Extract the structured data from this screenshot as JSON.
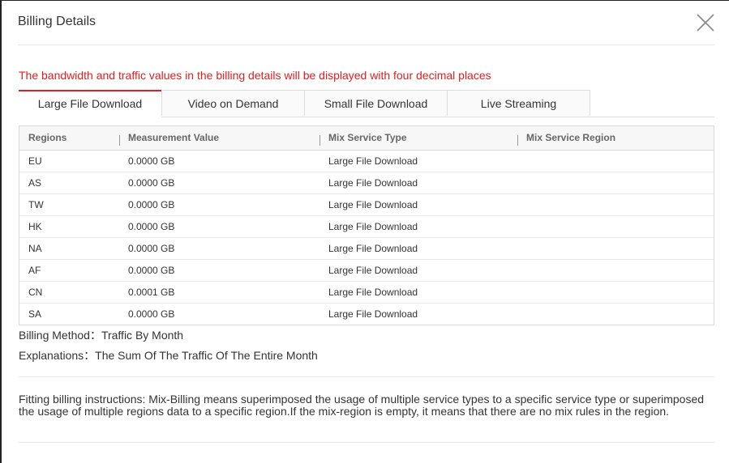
{
  "dialog": {
    "title": "Billing Details",
    "notice": "The bandwidth and traffic values in the billing details will be displayed with four decimal places"
  },
  "tabs": [
    {
      "label": "Large File Download",
      "active": true
    },
    {
      "label": "Video on Demand",
      "active": false
    },
    {
      "label": "Small File Download",
      "active": false
    },
    {
      "label": "Live Streaming",
      "active": false
    }
  ],
  "table": {
    "headers": [
      "Regions",
      "Measurement Value",
      "Mix Service Type",
      "Mix Service Region"
    ],
    "rows": [
      {
        "region": "EU",
        "value": "0.0000 GB",
        "type": "Large File Download",
        "mix_region": ""
      },
      {
        "region": "AS",
        "value": "0.0000 GB",
        "type": "Large File Download",
        "mix_region": ""
      },
      {
        "region": "TW",
        "value": "0.0000 GB",
        "type": "Large File Download",
        "mix_region": ""
      },
      {
        "region": "HK",
        "value": "0.0000 GB",
        "type": "Large File Download",
        "mix_region": ""
      },
      {
        "region": "NA",
        "value": "0.0000 GB",
        "type": "Large File Download",
        "mix_region": ""
      },
      {
        "region": "AF",
        "value": "0.0000 GB",
        "type": "Large File Download",
        "mix_region": ""
      },
      {
        "region": "CN",
        "value": "0.0001 GB",
        "type": "Large File Download",
        "mix_region": ""
      },
      {
        "region": "SA",
        "value": "0.0000 GB",
        "type": "Large File Download",
        "mix_region": ""
      }
    ]
  },
  "billing": {
    "method_label": "Billing Method：",
    "method_value": "Traffic By Month",
    "explanation_label": "Explanations：",
    "explanation_value": "The Sum Of The Traffic Of The Entire Month"
  },
  "fitting_instructions": "Fitting billing instructions: Mix-Billing means superimposed the usage of multiple service types to a specific service type or superimposed the usage of multiple regions data to a specific region.If the mix-region is empty, it means that there are no mix rules in the region.",
  "colors": {
    "accent": "#e02020",
    "border": "#d9d9d9",
    "header_bg": "#f7f7f7"
  },
  "icons": {
    "close": "close-icon"
  }
}
